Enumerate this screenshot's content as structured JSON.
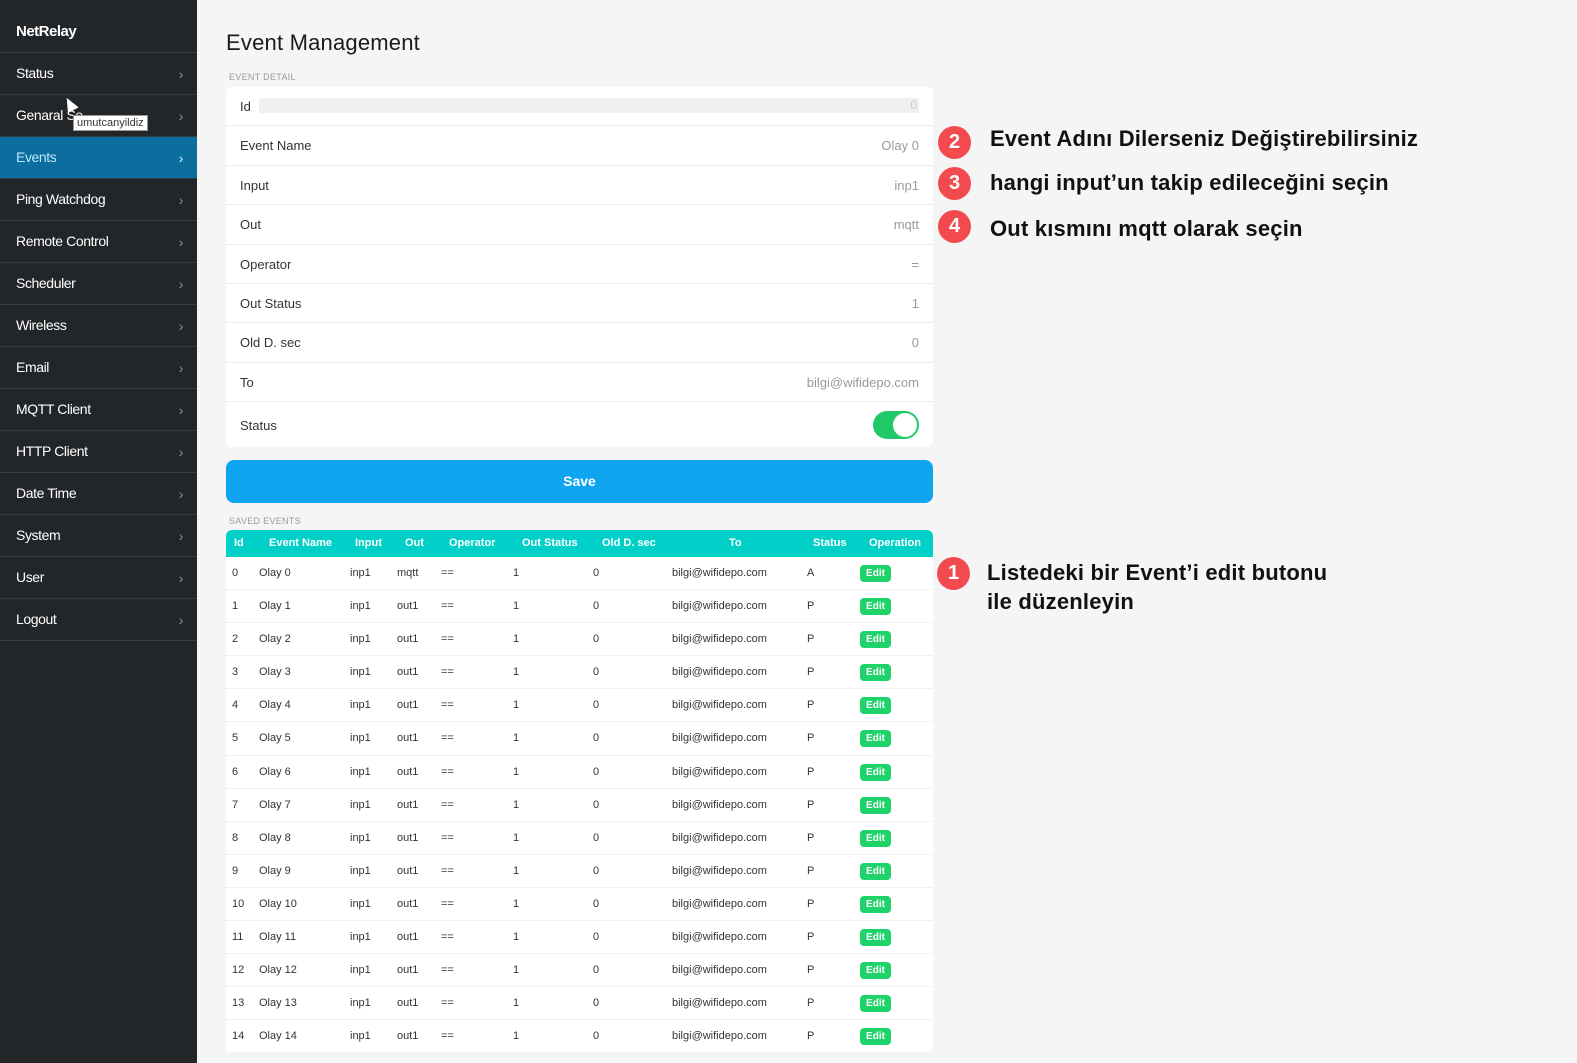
{
  "app": {
    "brand": "NetRelay"
  },
  "sidebar": {
    "items": [
      {
        "label": "Status"
      },
      {
        "label": "Genaral Se"
      },
      {
        "label": "Events"
      },
      {
        "label": "Ping Watchdog"
      },
      {
        "label": "Remote Control"
      },
      {
        "label": "Scheduler"
      },
      {
        "label": "Wireless"
      },
      {
        "label": "Email"
      },
      {
        "label": "MQTT Client"
      },
      {
        "label": "HTTP Client"
      },
      {
        "label": "Date Time"
      },
      {
        "label": "System"
      },
      {
        "label": "User"
      },
      {
        "label": "Logout"
      }
    ],
    "active_index": 2,
    "tooltip": "umutcanyildiz"
  },
  "page": {
    "title": "Event Management",
    "detail_section": "EVENT DETAIL",
    "saved_section": "SAVED EVENTS",
    "save_label": "Save"
  },
  "detail": {
    "id": {
      "label": "Id",
      "value": "0"
    },
    "event_name": {
      "label": "Event Name",
      "value": "Olay 0"
    },
    "input": {
      "label": "Input",
      "value": "inp1"
    },
    "out": {
      "label": "Out",
      "value": "mqtt"
    },
    "operator": {
      "label": "Operator",
      "value": "="
    },
    "out_status": {
      "label": "Out Status",
      "value": "1"
    },
    "old_d_sec": {
      "label": "Old D. sec",
      "value": "0"
    },
    "to": {
      "label": "To",
      "value": "bilgi@wifidepo.com"
    },
    "status": {
      "label": "Status",
      "enabled": true
    }
  },
  "table": {
    "headers": [
      "Id",
      "Event Name",
      "Input",
      "Out",
      "Operator",
      "Out Status",
      "Old D. sec",
      "To",
      "Status",
      "Operation"
    ],
    "edit_label": "Edit",
    "rows": [
      [
        "0",
        "Olay 0",
        "inp1",
        "mqtt",
        "==",
        "1",
        "0",
        "bilgi@wifidepo.com",
        "A"
      ],
      [
        "1",
        "Olay 1",
        "inp1",
        "out1",
        "==",
        "1",
        "0",
        "bilgi@wifidepo.com",
        "P"
      ],
      [
        "2",
        "Olay 2",
        "inp1",
        "out1",
        "==",
        "1",
        "0",
        "bilgi@wifidepo.com",
        "P"
      ],
      [
        "3",
        "Olay 3",
        "inp1",
        "out1",
        "==",
        "1",
        "0",
        "bilgi@wifidepo.com",
        "P"
      ],
      [
        "4",
        "Olay 4",
        "inp1",
        "out1",
        "==",
        "1",
        "0",
        "bilgi@wifidepo.com",
        "P"
      ],
      [
        "5",
        "Olay 5",
        "inp1",
        "out1",
        "==",
        "1",
        "0",
        "bilgi@wifidepo.com",
        "P"
      ],
      [
        "6",
        "Olay 6",
        "inp1",
        "out1",
        "==",
        "1",
        "0",
        "bilgi@wifidepo.com",
        "P"
      ],
      [
        "7",
        "Olay 7",
        "inp1",
        "out1",
        "==",
        "1",
        "0",
        "bilgi@wifidepo.com",
        "P"
      ],
      [
        "8",
        "Olay 8",
        "inp1",
        "out1",
        "==",
        "1",
        "0",
        "bilgi@wifidepo.com",
        "P"
      ],
      [
        "9",
        "Olay 9",
        "inp1",
        "out1",
        "==",
        "1",
        "0",
        "bilgi@wifidepo.com",
        "P"
      ],
      [
        "10",
        "Olay 10",
        "inp1",
        "out1",
        "==",
        "1",
        "0",
        "bilgi@wifidepo.com",
        "P"
      ],
      [
        "11",
        "Olay 11",
        "inp1",
        "out1",
        "==",
        "1",
        "0",
        "bilgi@wifidepo.com",
        "P"
      ],
      [
        "12",
        "Olay 12",
        "inp1",
        "out1",
        "==",
        "1",
        "0",
        "bilgi@wifidepo.com",
        "P"
      ],
      [
        "13",
        "Olay 13",
        "inp1",
        "out1",
        "==",
        "1",
        "0",
        "bilgi@wifidepo.com",
        "P"
      ],
      [
        "14",
        "Olay 14",
        "inp1",
        "out1",
        "==",
        "1",
        "0",
        "bilgi@wifidepo.com",
        "P"
      ]
    ]
  },
  "annotations": [
    {
      "number": "1",
      "line1": "Listedeki bir Event’i edit butonu",
      "line2": "ile düzenleyin"
    },
    {
      "number": "2",
      "text": "Event Adını Dilerseniz Değiştirebilirsiniz"
    },
    {
      "number": "3",
      "text": "hangi input’un takip edileceğini seçin"
    },
    {
      "number": "4",
      "text": "Out kısmını mqtt olarak seçin"
    }
  ],
  "colors": {
    "sidebar_bg": "#232629",
    "active_nav": "#0b6e9e",
    "table_header": "#00d0c8",
    "save_button": "#0fa4f0",
    "edit_button": "#1fd36b",
    "toggle_on": "#1fc967",
    "badge": "#f24a4f"
  }
}
